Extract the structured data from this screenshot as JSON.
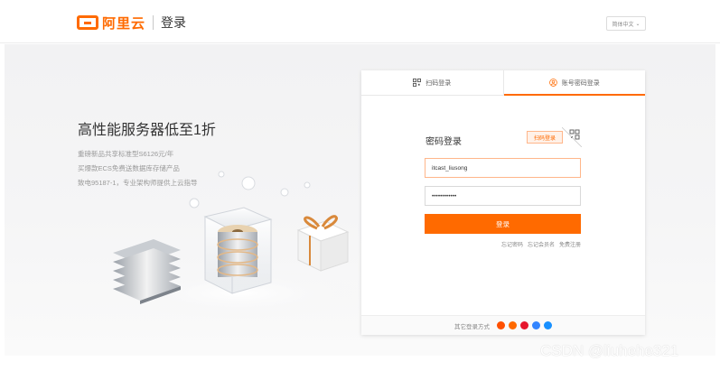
{
  "header": {
    "logo_text": "阿里云",
    "page_title": "登录",
    "language": "简体中文"
  },
  "banner": {
    "headline": "高性能服务器低至1折",
    "lines": [
      "重磅新品共享标准型S6126元/年",
      "买爆款ECS免费送数据库存储产品",
      "致电95187-1，专业架构师提供上云指导"
    ]
  },
  "login": {
    "tabs": [
      {
        "label": "扫码登录",
        "icon": "qr-code-icon"
      },
      {
        "label": "账号密码登录",
        "icon": "user-icon",
        "active": true
      }
    ],
    "title": "密码登录",
    "qr_tip": "扫码登录",
    "username_value": "itcast_liusong",
    "password_value": "••••••••••••",
    "submit_label": "登录",
    "links": [
      "忘记密码",
      "忘记会员名",
      "免费注册"
    ],
    "other_label": "其它登录方式",
    "social_icons": [
      {
        "name": "taobao-icon",
        "color": "#ff5000"
      },
      {
        "name": "alipay-icon",
        "color": "#ff6a00"
      },
      {
        "name": "weibo-icon",
        "color": "#e6162d"
      },
      {
        "name": "baidu-icon",
        "color": "#3385ff"
      },
      {
        "name": "dingtalk-icon",
        "color": "#1890ff"
      }
    ]
  },
  "watermark": "CSDN @liuhehe321",
  "colors": {
    "accent": "#ff6a00"
  }
}
